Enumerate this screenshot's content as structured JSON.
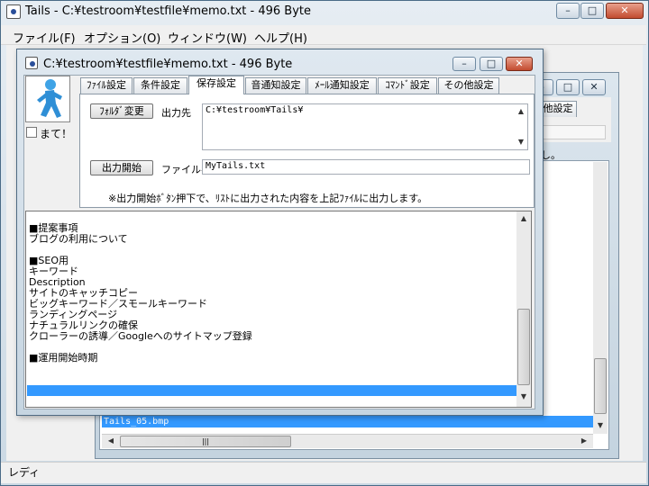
{
  "main": {
    "title": "Tails - C:¥testroom¥testfile¥memo.txt - 496 Byte",
    "menu": [
      "ファイル(F)",
      "オプション(O)",
      "ウィンドウ(W)",
      "ヘルプ(H)"
    ],
    "status": "レディ",
    "min": "–",
    "max": "□",
    "close": "✕"
  },
  "background": {
    "partial_tab": "他設定",
    "partial_text": "し。",
    "selected_item": "Tails_05.bmp",
    "hscroll_grip": "|||"
  },
  "dialog": {
    "title": "C:¥testroom¥testfile¥memo.txt - 496 Byte",
    "tabs": [
      "ﾌｧｲﾙ設定",
      "条件設定",
      "保存設定",
      "音通知設定",
      "ﾒｰﾙ通知設定",
      "ｺﾏﾝﾄﾞ設定",
      "その他設定"
    ],
    "active_tab": 2,
    "checkbox_label": "まて！",
    "folder_button": "ﾌｫﾙﾀﾞ変更",
    "output_label": "出力先",
    "output_path": "C:¥testroom¥Tails¥",
    "start_button": "出力開始",
    "filename_label": "ファイル名",
    "filename_value": "MyTails.txt",
    "note": "※出力開始ﾎﾞﾀﾝ押下で、ﾘｽﾄに出力された内容を上記ﾌｧｲﾙに出力します。",
    "memo_lines": [
      "■提案事項",
      "ブログの利用について",
      "",
      "■SEO用",
      "キーワード",
      "Description",
      "サイトのキャッチコピー",
      "ビッグキーワード／スモールキーワード",
      "ランディングページ",
      "ナチュラルリンクの確保",
      "クローラーの誘導／Googleへのサイトマップ登録",
      "",
      "■運用開始時期"
    ]
  },
  "colors": {
    "selection": "#3399ff",
    "titlebar": "#dbe5ee"
  },
  "icons": {
    "char": "runner-character-icon",
    "app": "tails-app-icon"
  }
}
